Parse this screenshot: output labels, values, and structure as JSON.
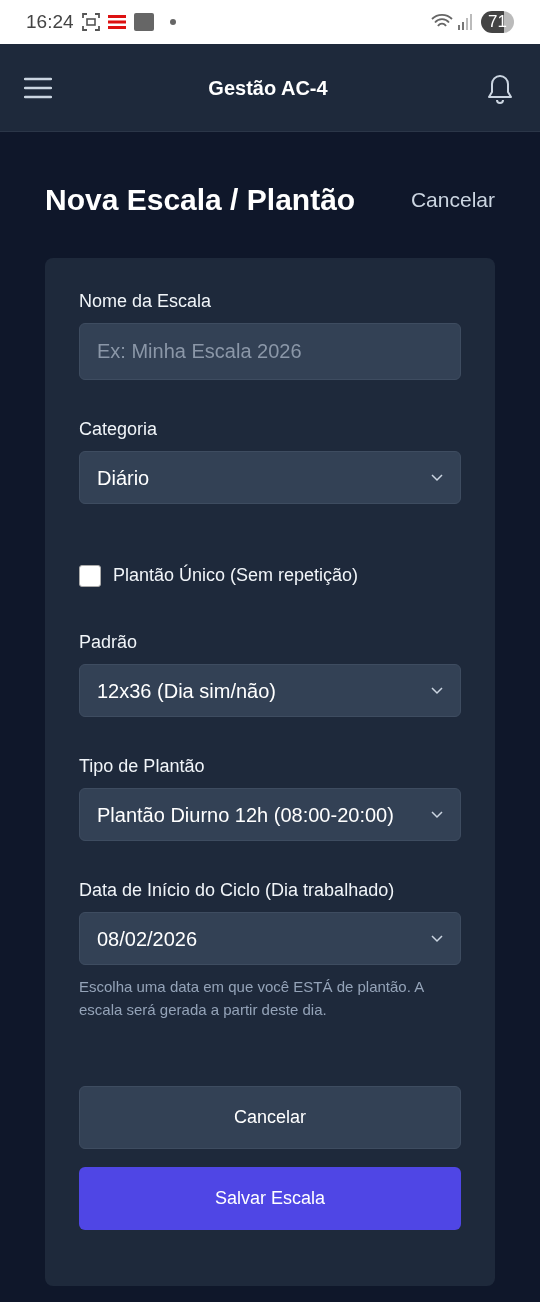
{
  "status_bar": {
    "time": "16:24",
    "battery": "71"
  },
  "app_bar": {
    "title": "Gestão AC-4"
  },
  "page": {
    "title": "Nova Escala / Plantão",
    "cancel_link": "Cancelar"
  },
  "form": {
    "fields": [
      {
        "kind": "text",
        "label": "Nome da Escala",
        "placeholder": "Ex: Minha Escala 2026"
      },
      {
        "kind": "select",
        "label": "Categoria",
        "value": "Diário"
      },
      {
        "kind": "checkbox",
        "label": "Plantão Único (Sem repetição)",
        "checked": false
      },
      {
        "kind": "select",
        "label": "Padrão",
        "value": "12x36 (Dia sim/não)"
      },
      {
        "kind": "select",
        "label": "Tipo de Plantão",
        "value": "Plantão Diurno 12h (08:00-20:00)"
      },
      {
        "kind": "select",
        "label": "Data de Início do Ciclo (Dia trabalhado)",
        "value": "08/02/2026",
        "help": "Escolha uma data em que você ESTÁ de plantão. A escala será gerada a partir deste dia."
      }
    ],
    "buttons": [
      {
        "kind": "secondary",
        "label": "Cancelar"
      },
      {
        "kind": "primary",
        "label": "Salvar Escala"
      }
    ]
  }
}
